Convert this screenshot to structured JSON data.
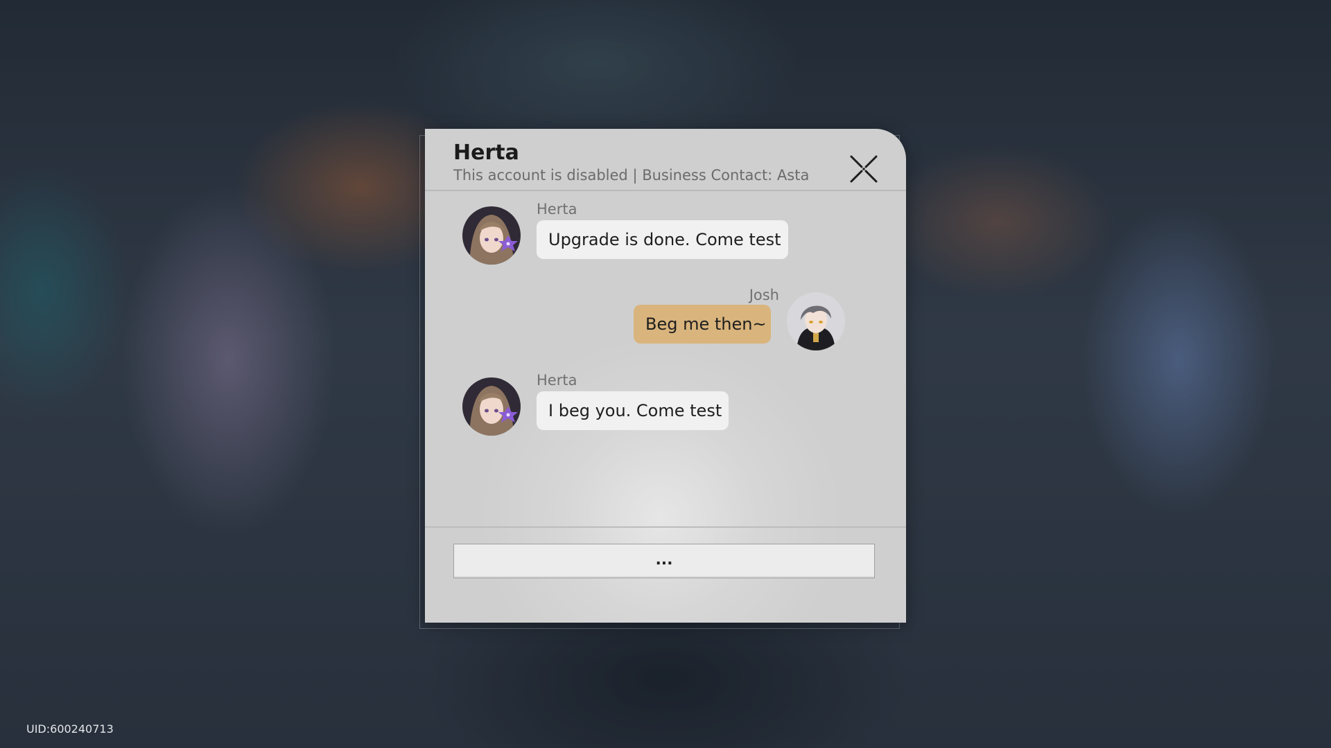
{
  "chat": {
    "title": "Herta",
    "subtitle": "This account is disabled | Business Contact: Asta",
    "close_icon": "close-x-icon",
    "messages": [
      {
        "sender": "Herta",
        "text": "Upgrade is done. Come test",
        "direction": "incoming"
      },
      {
        "sender": "Josh",
        "text": "Beg me then~",
        "direction": "outgoing"
      },
      {
        "sender": "Herta",
        "text": "I beg you. Come test",
        "direction": "incoming"
      }
    ],
    "reply_option": "..."
  },
  "footer": {
    "uid": "UID:600240713"
  },
  "colors": {
    "incoming_bubble": "#f1f1f1",
    "outgoing_bubble": "#d9b47c",
    "dialog_bg": "#d6d6d6"
  }
}
